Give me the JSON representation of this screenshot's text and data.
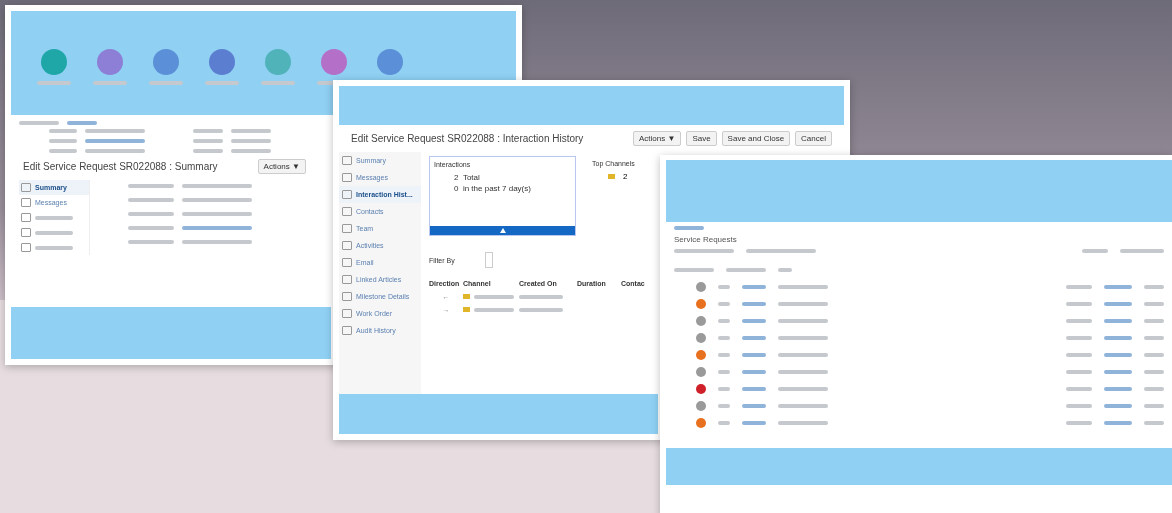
{
  "summary_window": {
    "title": "Edit Service Request SR022088 : Summary",
    "actions_button": "Actions ▼",
    "nav_icons": [
      {
        "color": "#1fa7a8"
      },
      {
        "color": "#8d7fd6"
      },
      {
        "color": "#5b8fd8"
      },
      {
        "color": "#5b7ed0"
      },
      {
        "color": "#4fb3b9"
      },
      {
        "color": "#b46fc9"
      },
      {
        "color": "#5b8fd8"
      }
    ],
    "sidebar": [
      {
        "label": "Summary",
        "selected": true
      },
      {
        "label": "Messages",
        "selected": false
      },
      {
        "selected": false
      },
      {
        "selected": false
      },
      {
        "selected": false
      }
    ]
  },
  "history_window": {
    "title": "Edit Service Request SR022088 : Interaction History",
    "buttons": [
      "Actions ▼",
      "Save",
      "Save and Close",
      "Cancel"
    ],
    "sidebar": [
      {
        "label": "Summary",
        "selected": false
      },
      {
        "label": "Messages",
        "selected": false
      },
      {
        "label": "Interaction Hist...",
        "selected": true
      },
      {
        "label": "Contacts",
        "selected": false
      },
      {
        "label": "Team",
        "selected": false
      },
      {
        "label": "Activities",
        "selected": false
      },
      {
        "label": "Email",
        "selected": false
      },
      {
        "label": "Linked Articles",
        "selected": false
      },
      {
        "label": "Milestone Details",
        "selected": false
      },
      {
        "label": "Work Order",
        "selected": false
      },
      {
        "label": "Audit History",
        "selected": false
      }
    ],
    "interactions": {
      "title": "Interactions",
      "stats": [
        {
          "count": "2",
          "label": "Total"
        },
        {
          "count": "0",
          "label": "in the past 7 day(s)"
        }
      ]
    },
    "top_channels": {
      "title": "Top Channels",
      "count": "2"
    },
    "filter_label": "Filter By",
    "columns": [
      "Direction",
      "Channel",
      "Created On",
      "Duration",
      "Contac"
    ],
    "rows": [
      {
        "direction": "←"
      },
      {
        "direction": "→"
      }
    ]
  },
  "requests_window": {
    "title": "Service Requests",
    "rows": [
      {
        "color": "#9a9a9a"
      },
      {
        "color": "#e8711f"
      },
      {
        "color": "#9a9a9a"
      },
      {
        "color": "#9a9a9a"
      },
      {
        "color": "#e8711f"
      },
      {
        "color": "#9a9a9a"
      },
      {
        "color": "#d0202a"
      },
      {
        "color": "#9a9a9a"
      },
      {
        "color": "#e8711f"
      }
    ]
  }
}
